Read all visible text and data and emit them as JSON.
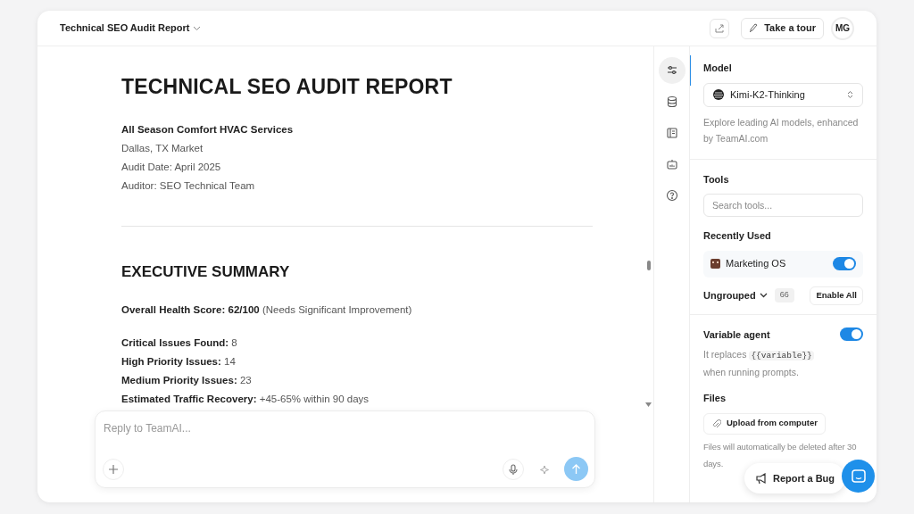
{
  "header": {
    "title": "Technical SEO Audit Report",
    "tour_button": "Take a tour",
    "avatar": "MG"
  },
  "document": {
    "title": "TECHNICAL SEO AUDIT REPORT",
    "company": "All Season Comfort HVAC Services",
    "meta": [
      "Dallas, TX Market",
      "Audit Date: April 2025",
      "Auditor: SEO Technical Team"
    ],
    "section_title": "EXECUTIVE SUMMARY",
    "score_line": "**Overall Health Score: 62/100** (Needs Significant Improvement)",
    "stats": [
      "**Critical Issues Found:** 8",
      "**High Priority Issues:** 14",
      "**Medium Priority Issues:** 23",
      "**Estimated Traffic Recovery:** +45-65% within 90 days"
    ]
  },
  "composer": {
    "placeholder": "Reply to TeamAI..."
  },
  "rail": [
    {
      "kind": "sliders",
      "selected": true
    },
    {
      "kind": "database",
      "selected": false
    },
    {
      "kind": "panel",
      "selected": false
    },
    {
      "kind": "robot",
      "selected": false
    },
    {
      "kind": "help",
      "selected": false
    }
  ],
  "panel": {
    "model_label": "Model",
    "model": "Kimi-K2-Thinking",
    "model_note": "Explore leading AI models, enhanced by TeamAI.com",
    "tools_label": "Tools",
    "tools_placeholder": "Search tools...",
    "recent_label": "Recently Used",
    "recent": [
      {
        "name": "Marketing OS",
        "on": true
      }
    ],
    "group": "Ungrouped",
    "group_count": "66",
    "enable_all": "Enable All",
    "variable_label": "Variable agent",
    "variable_on": true,
    "variable_note_before": "It replaces",
    "variable_code": "{{variable}}",
    "variable_note_after": "when running prompts.",
    "files_label": "Files",
    "upload": "Upload from computer",
    "files_note": "Files will automatically be deleted after 30 days."
  },
  "report_bug": "Report a Bug"
}
